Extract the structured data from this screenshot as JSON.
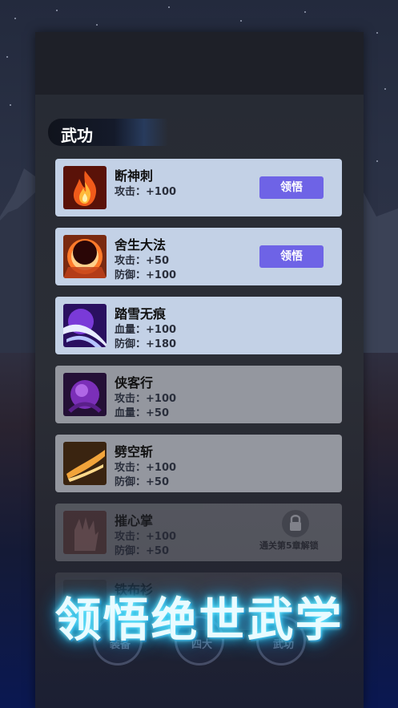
{
  "section": {
    "title": "武功"
  },
  "skills": [
    {
      "name": "断神刺",
      "stat1": "攻击：+100",
      "stat2": "",
      "button": "领悟",
      "icon": "fire-skill-icon"
    },
    {
      "name": "舍生大法",
      "stat1": "攻击：+50",
      "stat2": "防御：+100",
      "button": "领悟",
      "icon": "sun-ring-skill-icon"
    },
    {
      "name": "踏雪无痕",
      "stat1": "血量：+100",
      "stat2": "防御：+180",
      "icon": "wind-slash-skill-icon"
    },
    {
      "name": "侠客行",
      "stat1": "攻击：+100",
      "stat2": "血量：+50",
      "icon": "purple-orb-skill-icon"
    },
    {
      "name": "劈空斩",
      "stat1": "攻击：+100",
      "stat2": "防御：+50",
      "icon": "golden-slash-skill-icon"
    },
    {
      "name": "摧心掌",
      "stat1": "攻击：+100",
      "stat2": "防御：+50",
      "lock_text": "通关第5章解锁",
      "icon": "palm-skill-icon"
    },
    {
      "name": "铁布衫",
      "icon": "armor-skill-icon"
    }
  ],
  "bottom_nav": [
    "装备",
    "四大",
    "武功"
  ],
  "banner": "领悟绝世武学",
  "colors": {
    "button": "#6e63e6",
    "card_active": "#c3d1e6",
    "banner_glow": "#2bd9ff"
  }
}
